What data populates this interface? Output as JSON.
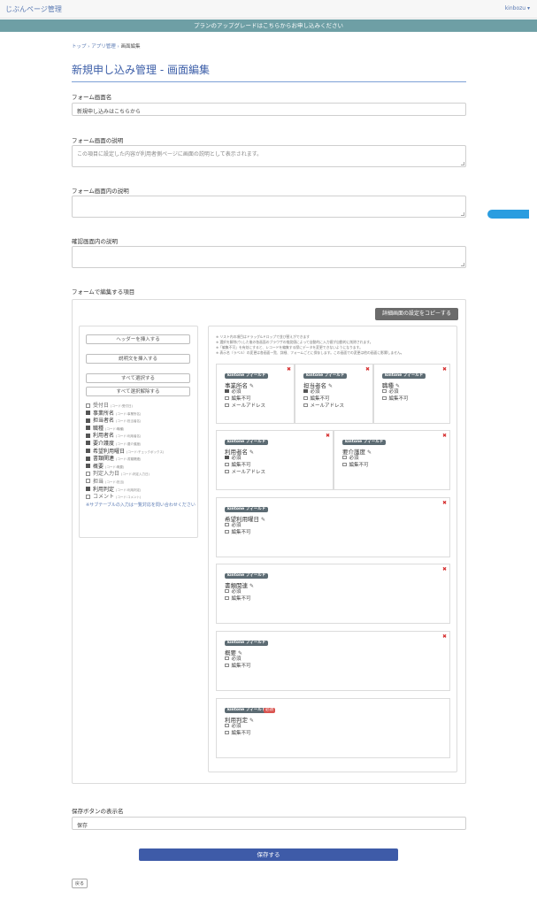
{
  "header": {
    "brand": "じぶんページ管理",
    "user": "kinbozu ▾"
  },
  "banner": {
    "text": "プランのアップグレードはこちらからお申し込みください"
  },
  "breadcrumb": {
    "top": "トップ",
    "sep1": " › ",
    "apps": "アプリ管理",
    "sep2": " › ",
    "current": "画面編集"
  },
  "page": {
    "title": "新規申し込み管理 - 画面編集"
  },
  "form": {
    "form_name_label": "フォーム画面名",
    "form_name_value": "新規申し込みはこちらから",
    "description_label": "フォーム画面の説明",
    "description_placeholder": "この項目に設定した内容が利用者側ページに画面の説明として表示されます。",
    "inner_description_label": "フォーム画面内の説明",
    "confirm_description_label": "確認画面内の説明",
    "edit_items_label": "フォームで編集する項目",
    "save_label_title": "保存ボタンの表示名",
    "save_label_value": "保存"
  },
  "editor": {
    "copy_button": "詳細画面の設定をコピーする",
    "insert_header": "ヘッダーを挿入する",
    "insert_description": "説明文を挿入する",
    "select_all": "すべて選択する",
    "deselect_all": "すべて選択解除する",
    "fields": [
      {
        "name": "受付日",
        "code": "(コード:受付日)",
        "checked": false
      },
      {
        "name": "事業所名",
        "code": "(コード:事業所名)",
        "checked": true
      },
      {
        "name": "担当者名",
        "code": "(コード:担当者名)",
        "checked": true
      },
      {
        "name": "職種",
        "code": "(コード:職種)",
        "checked": true
      },
      {
        "name": "利用者名",
        "code": "(コード:利用者名)",
        "checked": true
      },
      {
        "name": "要介護度",
        "code": "(コード:要介護度)",
        "checked": true
      },
      {
        "name": "希望利用曜日",
        "code": "(コード:チェックボックス)",
        "checked": true
      },
      {
        "name": "書類関連",
        "code": "(コード:書類関連)",
        "checked": true
      },
      {
        "name": "概要",
        "code": "(コード:概要)",
        "checked": true
      },
      {
        "name": "判定入力日",
        "code": "(コード:判定入力日)",
        "checked": false
      },
      {
        "name": "担当",
        "code": "(コード:担当)",
        "checked": false
      },
      {
        "name": "利用判定",
        "code": "(コード:利用判定)",
        "checked": true
      },
      {
        "name": "コメント",
        "code": "(コード:コメント)",
        "checked": false
      }
    ],
    "subtable_note": "※サブテーブルの入力は一覧対応を問い合わせください",
    "notes": [
      "※ リスト内の項目はドラッグ&ドロップで並び替えができます",
      "※ 選択を解除(ウ)した後の各画面のブラウザの推奨値によって自動的に入力値が自動的に削除されます。",
      "※「編集不可」を有効にすると、レコードを編集する際にデータを変更できないようになります。",
      "※ 表示名（ラベル）の変更は各画面一覧、詳細、フォームごとに保存します。この画面での変更は他の画面に影響しません。"
    ],
    "badge": "kintone フィールド",
    "required_badge": "必須",
    "opt_required": "必須",
    "opt_readonly": "編集不可",
    "opt_email": "メールアドレス",
    "cards": [
      {
        "name": "事業所名",
        "required": true,
        "readonly": false,
        "email": false,
        "has_email": true
      },
      {
        "name": "担当者名",
        "required": true,
        "readonly": false,
        "email": false,
        "has_email": true
      },
      {
        "name": "職種",
        "required": false,
        "readonly": false,
        "has_email": false
      },
      {
        "name": "利用者名",
        "required": true,
        "readonly": false,
        "email": false,
        "has_email": true
      },
      {
        "name": "要介護度",
        "required": false,
        "readonly": false,
        "has_email": false
      },
      {
        "name": "希望利用曜日",
        "required": false,
        "readonly": false,
        "has_email": false
      },
      {
        "name": "書類関連",
        "required": false,
        "readonly": false,
        "has_email": false
      },
      {
        "name": "概要",
        "required": false,
        "readonly": false,
        "has_email": false
      },
      {
        "name": "利用判定",
        "required": false,
        "readonly": false,
        "has_email": false
      }
    ]
  },
  "actions": {
    "save_button": "保存する",
    "back_button": "戻る"
  },
  "colors": {
    "brand_blue": "#3e5ba8",
    "banner_teal": "#6e9fa5",
    "remove_red": "#d62f2f"
  }
}
